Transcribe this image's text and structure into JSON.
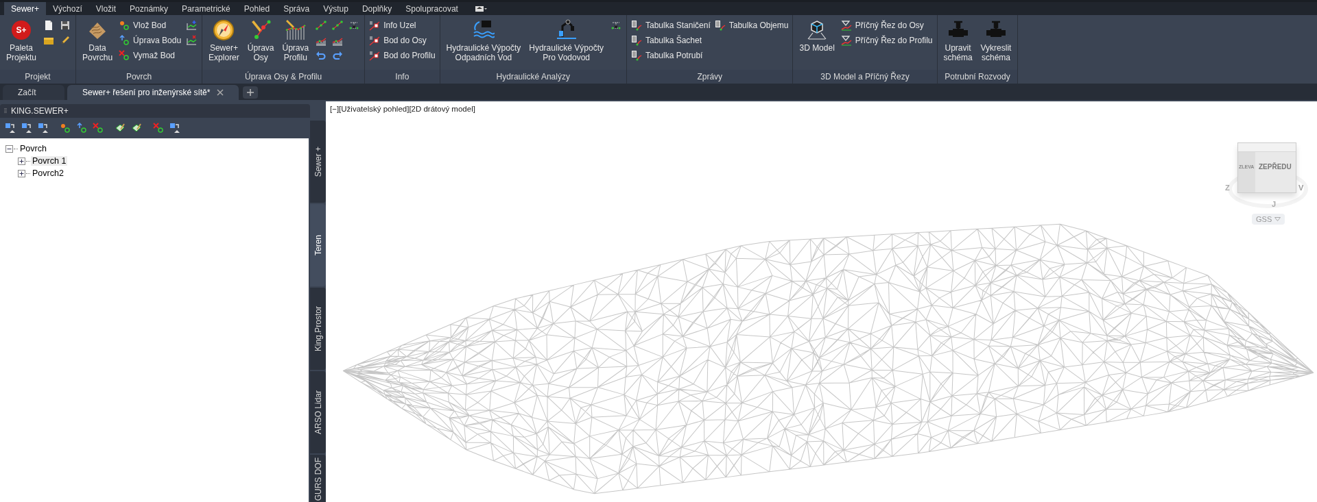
{
  "menu_tabs": [
    {
      "label": "Sewer+",
      "selected": true
    },
    {
      "label": "Výchozí",
      "selected": false
    },
    {
      "label": "Vložit",
      "selected": false
    },
    {
      "label": "Poznámky",
      "selected": false
    },
    {
      "label": "Parametrické",
      "selected": false
    },
    {
      "label": "Pohled",
      "selected": false
    },
    {
      "label": "Správa",
      "selected": false
    },
    {
      "label": "Výstup",
      "selected": false
    },
    {
      "label": "Doplňky",
      "selected": false
    },
    {
      "label": "Spolupracovat",
      "selected": false
    }
  ],
  "ribbon": {
    "panels": [
      {
        "title": "Projekt",
        "groups": [
          {
            "kind": "big",
            "label": "Paleta\nProjektu",
            "badge": "S+"
          },
          {
            "kind": "stack",
            "items": [
              {
                "kind": "icon"
              },
              {
                "kind": "icon"
              }
            ]
          },
          {
            "kind": "stack",
            "items": [
              {
                "kind": "icon"
              },
              {
                "kind": "icon"
              }
            ]
          }
        ]
      },
      {
        "title": "Povrch",
        "groups": [
          {
            "kind": "big",
            "label": "Data\nPovrchu"
          },
          {
            "kind": "stack",
            "items": [
              {
                "kind": "small",
                "label": "Vlož Bod"
              },
              {
                "kind": "small",
                "label": "Úprava Bodu"
              },
              {
                "kind": "small",
                "label": "Vymaž Bod"
              }
            ]
          },
          {
            "kind": "stack",
            "items": [
              {
                "kind": "icon"
              },
              {
                "kind": "icon"
              }
            ]
          }
        ]
      },
      {
        "title": "Úprava Osy & Profilu",
        "groups": [
          {
            "kind": "big",
            "label": "Sewer+\nExplorer"
          },
          {
            "kind": "big",
            "label": "Úprava\nOsy"
          },
          {
            "kind": "big",
            "label": "Úprava\nProfilu"
          },
          {
            "kind": "stack",
            "items": [
              {
                "kind": "icon"
              },
              {
                "kind": "icon"
              },
              {
                "kind": "icon"
              }
            ]
          },
          {
            "kind": "stack",
            "items": [
              {
                "kind": "icon"
              },
              {
                "kind": "icon"
              },
              {
                "kind": "icon"
              }
            ]
          },
          {
            "kind": "stack",
            "items": [
              {
                "kind": "icon"
              }
            ]
          }
        ]
      },
      {
        "title": "Info",
        "groups": [
          {
            "kind": "stack",
            "items": [
              {
                "kind": "small",
                "label": "Info Uzel"
              },
              {
                "kind": "small",
                "label": "Bod do Osy"
              },
              {
                "kind": "small",
                "label": "Bod do Profilu"
              }
            ]
          }
        ]
      },
      {
        "title": "Hydraulické Analýzy",
        "groups": [
          {
            "kind": "big",
            "label": "Hydraulické Výpočty\nOdpadních Vod"
          },
          {
            "kind": "big",
            "label": "Hydraulické Výpočty\nPro Vodovod"
          },
          {
            "kind": "stack",
            "items": [
              {
                "kind": "icon"
              }
            ]
          }
        ]
      },
      {
        "title": "Zprávy",
        "groups": [
          {
            "kind": "stack",
            "items": [
              {
                "kind": "small",
                "label": "Tabulka Staničení"
              },
              {
                "kind": "small",
                "label": "Tabulka Šachet"
              },
              {
                "kind": "small",
                "label": "Tabulka Potrubí"
              }
            ]
          },
          {
            "kind": "stack",
            "items": [
              {
                "kind": "small",
                "label": "Tabulka Objemu"
              }
            ]
          }
        ]
      },
      {
        "title": "3D Model a Příčný Řezy",
        "groups": [
          {
            "kind": "big",
            "label": "3D Model"
          },
          {
            "kind": "stack",
            "items": [
              {
                "kind": "small",
                "label": "Příčný Řez do Osy"
              },
              {
                "kind": "small",
                "label": "Příčný Řez do Profilu"
              }
            ]
          }
        ]
      },
      {
        "title": "Potrubní Rozvody",
        "groups": [
          {
            "kind": "big",
            "label": "Upravit\nschéma"
          },
          {
            "kind": "big",
            "label": "Vykreslit\nschéma"
          }
        ]
      }
    ]
  },
  "doc_tabs": [
    {
      "label": "Začít",
      "selected": false
    },
    {
      "label": "Sewer+ řešení pro inženýrské sítě*",
      "selected": true
    }
  ],
  "palette": {
    "title": "KING.SEWER+",
    "tree": [
      {
        "label": "Povrch",
        "expanded": true,
        "selected": false,
        "children": [
          {
            "label": "Povrch 1",
            "expanded": false,
            "selected": true
          },
          {
            "label": "Povrch2",
            "expanded": false,
            "selected": false
          }
        ]
      }
    ]
  },
  "side_tabs": [
    {
      "label": "Sewer +",
      "selected": false
    },
    {
      "label": "Teren",
      "selected": true
    },
    {
      "label": "King.Prostor",
      "selected": false
    },
    {
      "label": "ARSO Lidar",
      "selected": false
    },
    {
      "label": "GURS DOF",
      "selected": false
    }
  ],
  "viewport": {
    "label": "[−][Uživatelský pohled][2D drátový model]",
    "viewcube": {
      "left_face": "ZLEVA",
      "front_face": "ZEPŘEDU",
      "compass": [
        "Z",
        "J",
        "V"
      ],
      "ucs": "GSS"
    }
  }
}
